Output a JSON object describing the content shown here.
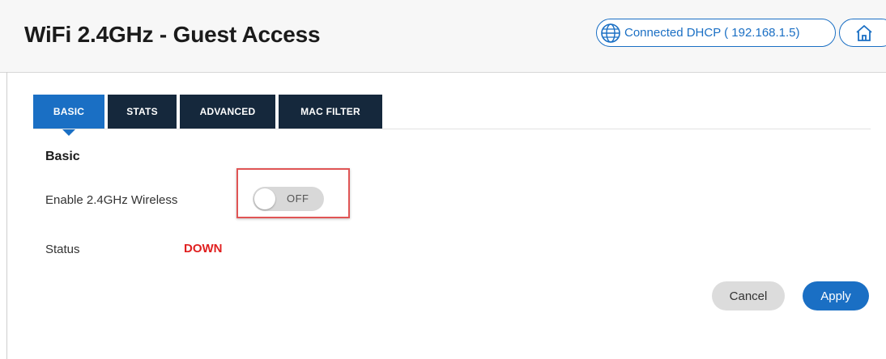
{
  "header": {
    "title": "WiFi 2.4GHz - Guest Access",
    "connection": "Connected DHCP ( 192.168.1.5)",
    "connection_icon": "globe-icon",
    "home_icon": "home-icon"
  },
  "tabs": [
    {
      "label": "BASIC",
      "active": true
    },
    {
      "label": "STATS",
      "active": false
    },
    {
      "label": "ADVANCED",
      "active": false
    },
    {
      "label": "MAC FILTER",
      "active": false
    }
  ],
  "section": {
    "title": "Basic"
  },
  "fields": {
    "enable_label": "Enable 2.4GHz Wireless",
    "toggle_state": "OFF",
    "status_label": "Status",
    "status_value": "DOWN"
  },
  "actions": {
    "cancel": "Cancel",
    "apply": "Apply"
  },
  "colors": {
    "accent": "#1a6fc4",
    "tab_dark": "#15283c",
    "status_down": "#e02020",
    "highlight_box": "#e05555"
  }
}
